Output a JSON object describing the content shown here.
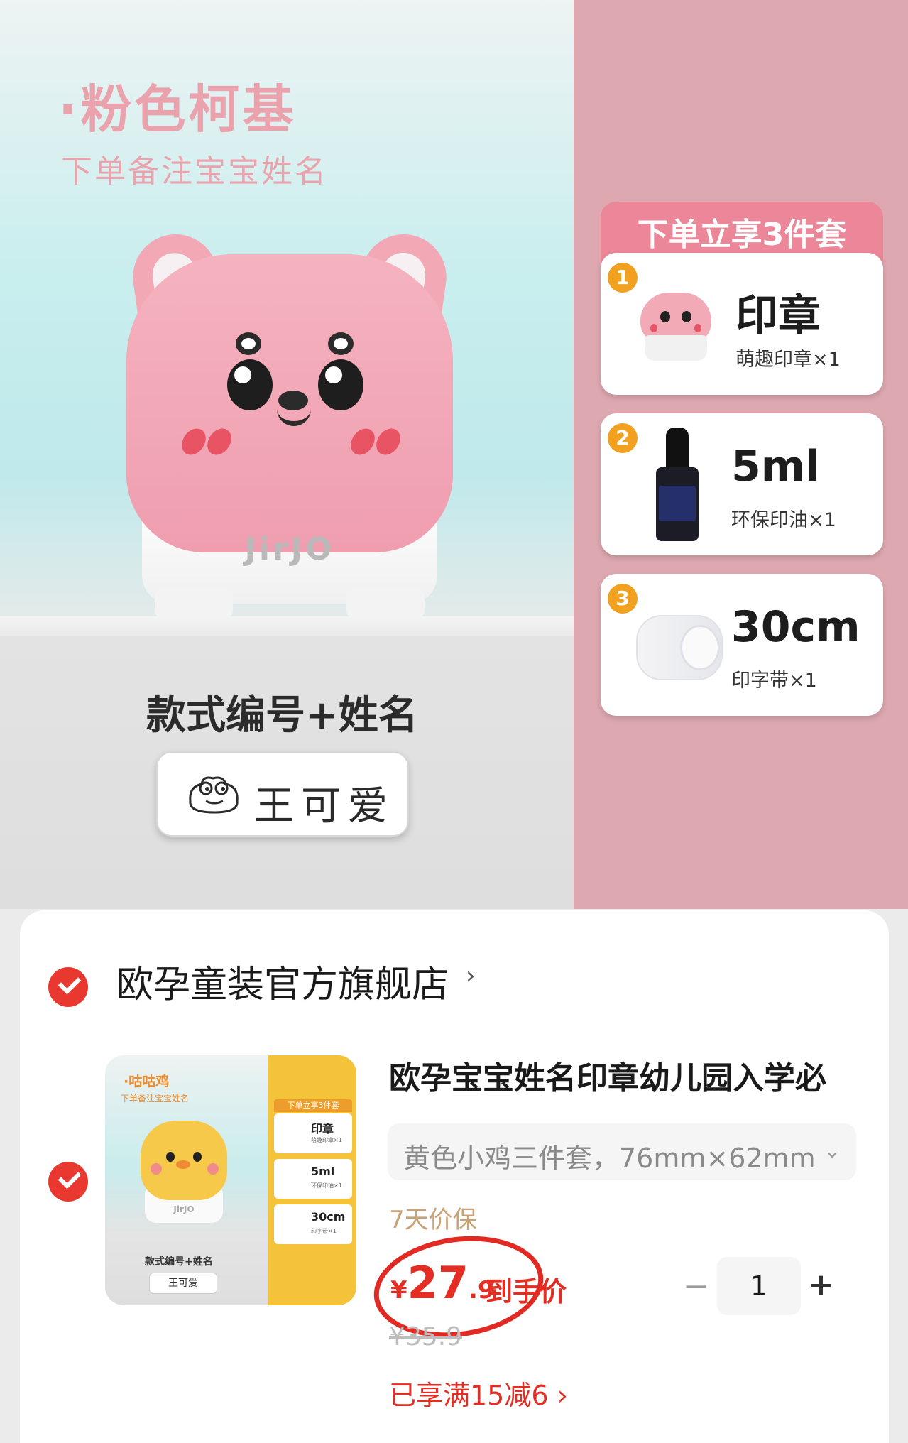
{
  "banner": {
    "color_title": "·粉色柯基",
    "subtitle": "下单备注宝宝姓名",
    "brand": "JirJO",
    "style_label": "款式编号+姓名",
    "name_sample": "王可爱",
    "kit": {
      "title": "下单立享3件套",
      "items": [
        {
          "num": "1",
          "big": "印章",
          "small": "萌趣印章×1",
          "icon": "stamp-icon"
        },
        {
          "num": "2",
          "big": "5ml",
          "small": "环保印油×1",
          "icon": "ink-bottle-icon"
        },
        {
          "num": "3",
          "big": "30cm",
          "small": "印字带×1",
          "icon": "tape-roll-icon"
        }
      ]
    }
  },
  "cart": {
    "shop_name": "欧孕童装官方旗舰店",
    "shop_chevron": "›",
    "product_title": "欧孕宝宝姓名印章幼儿园入学必",
    "thumbnail": {
      "title": "·咕咕鸡",
      "subtitle": "下单备注宝宝姓名",
      "brand": "JirJO",
      "style_label": "款式编号+姓名",
      "name_sample": "王可爱",
      "kit_title": "下单立享3件套",
      "kit_items": [
        {
          "big": "印章",
          "small": "萌趣印章×1"
        },
        {
          "big": "5ml",
          "small": "环保印油×1"
        },
        {
          "big": "30cm",
          "small": "印字带×1"
        }
      ]
    },
    "spec_text": "黄色小鸡三件套，76mm×62mm",
    "spec_arrow": "⌄",
    "guarantee": "7天价保",
    "price_currency": "¥",
    "price_int": "27",
    "price_dec": ".9",
    "price_note": "到手价",
    "original_price": "¥35.9",
    "discount": "已享满15减6 ›",
    "qty_minus": "−",
    "quantity": "1",
    "qty_plus": "+"
  },
  "colors": {
    "accent_red": "#e42e24",
    "banner_pink": "#dea8b0",
    "kit_header": "#eb8798"
  }
}
